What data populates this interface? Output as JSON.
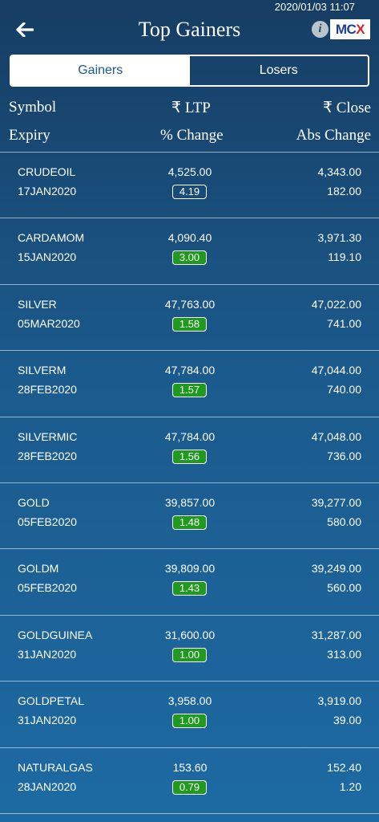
{
  "status": {
    "datetime": "2020/01/03 11:07"
  },
  "header": {
    "title": "Top Gainers",
    "info_label": "i",
    "logo_text_a": "MC",
    "logo_text_b": "X"
  },
  "tabs": [
    {
      "label": "Gainers",
      "active": true
    },
    {
      "label": "Losers",
      "active": false
    }
  ],
  "columns": {
    "symbol": "Symbol",
    "ltp": "₹ LTP",
    "close": "₹ Close",
    "expiry": "Expiry",
    "pct_change": "% Change",
    "abs_change": "Abs Change"
  },
  "rows": [
    {
      "symbol": "CRUDEOIL",
      "expiry": "17JAN2020",
      "ltp": "4,525.00",
      "pct": "4.19",
      "close": "4,343.00",
      "abs": "182.00",
      "pct_style": "blue"
    },
    {
      "symbol": "CARDAMOM",
      "expiry": "15JAN2020",
      "ltp": "4,090.40",
      "pct": "3.00",
      "close": "3,971.30",
      "abs": "119.10",
      "pct_style": "green"
    },
    {
      "symbol": "SILVER",
      "expiry": "05MAR2020",
      "ltp": "47,763.00",
      "pct": "1.58",
      "close": "47,022.00",
      "abs": "741.00",
      "pct_style": "green"
    },
    {
      "symbol": "SILVERM",
      "expiry": "28FEB2020",
      "ltp": "47,784.00",
      "pct": "1.57",
      "close": "47,044.00",
      "abs": "740.00",
      "pct_style": "green"
    },
    {
      "symbol": "SILVERMIC",
      "expiry": "28FEB2020",
      "ltp": "47,784.00",
      "pct": "1.56",
      "close": "47,048.00",
      "abs": "736.00",
      "pct_style": "green"
    },
    {
      "symbol": "GOLD",
      "expiry": "05FEB2020",
      "ltp": "39,857.00",
      "pct": "1.48",
      "close": "39,277.00",
      "abs": "580.00",
      "pct_style": "green"
    },
    {
      "symbol": "GOLDM",
      "expiry": "05FEB2020",
      "ltp": "39,809.00",
      "pct": "1.43",
      "close": "39,249.00",
      "abs": "560.00",
      "pct_style": "green"
    },
    {
      "symbol": "GOLDGUINEA",
      "expiry": "31JAN2020",
      "ltp": "31,600.00",
      "pct": "1.00",
      "close": "31,287.00",
      "abs": "313.00",
      "pct_style": "green"
    },
    {
      "symbol": "GOLDPETAL",
      "expiry": "31JAN2020",
      "ltp": "3,958.00",
      "pct": "1.00",
      "close": "3,919.00",
      "abs": "39.00",
      "pct_style": "green"
    },
    {
      "symbol": "NATURALGAS",
      "expiry": "28JAN2020",
      "ltp": "153.60",
      "pct": "0.79",
      "close": "152.40",
      "abs": "1.20",
      "pct_style": "green"
    }
  ]
}
